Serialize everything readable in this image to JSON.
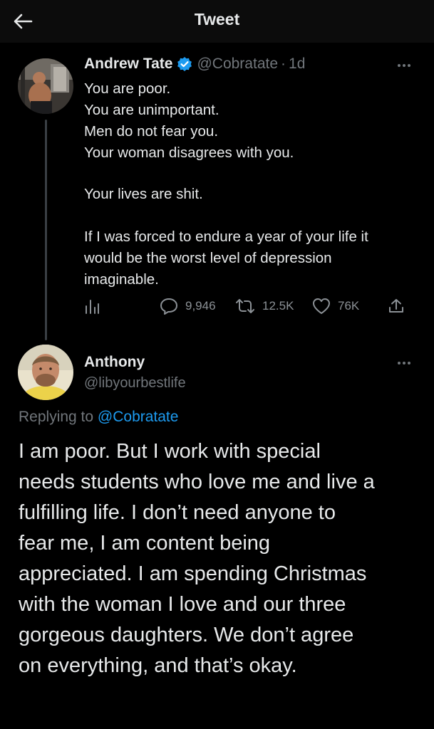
{
  "header": {
    "title": "Tweet"
  },
  "tweet": {
    "author": "Andrew Tate",
    "handle": "@Cobratate",
    "separator": "·",
    "time": "1d",
    "lines": [
      "You are poor.",
      "You are unimportant.",
      "Men do not fear you.",
      "Your woman disagrees with you.",
      "Your lives are shit.",
      "If I was forced to endure a year of your life it",
      "would be the worst level of depression",
      "imaginable."
    ],
    "stats": {
      "replies": "9,946",
      "retweets": "12.5K",
      "likes": "76K"
    }
  },
  "reply": {
    "author": "Anthony",
    "handle": "@libyourbestlife",
    "replying_prefix": "Replying to",
    "replying_to": "@Cobratate",
    "lines": [
      "I am poor. But I work with special",
      "needs students who love me and live a",
      "fulfilling life. I don’t need anyone to",
      "fear me, I am content being",
      "appreciated. I am spending Christmas",
      "with the woman I love and our three",
      "gorgeous daughters. We don’t agree",
      "on everything, and that’s okay."
    ]
  },
  "colors": {
    "background": "#000000",
    "text": "#e7e9ea",
    "muted": "#71767b",
    "accent": "#1d9bf0",
    "verified": "#1d9bf0"
  },
  "icons": [
    "back-arrow-icon",
    "verified-badge-icon",
    "more-icon",
    "analytics-icon",
    "reply-icon",
    "retweet-icon",
    "like-icon",
    "share-icon"
  ]
}
